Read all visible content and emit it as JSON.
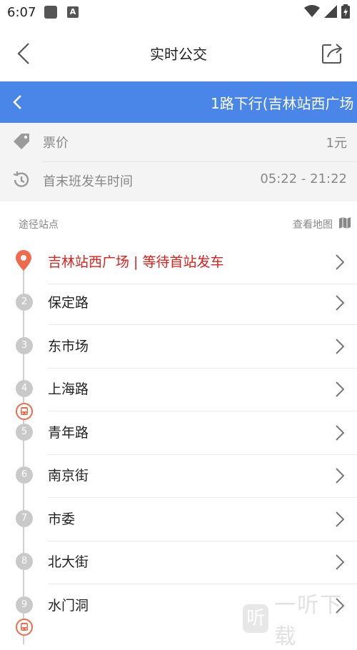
{
  "status_bar": {
    "time": "6:07",
    "notif_icon_letter": "A"
  },
  "app_bar": {
    "title": "实时公交"
  },
  "route_bar": {
    "route_title": "1路下行(吉林站西广场",
    "background": "#4a86e8"
  },
  "info": {
    "fare_label": "票价",
    "fare_value": "1元",
    "time_label": "首末班发车时间",
    "time_value": "05:22 - 21:22"
  },
  "stops_header": {
    "left": "途径站点",
    "right": "查看地图"
  },
  "stops": [
    {
      "index": "1",
      "name": "吉林站西广场 | 等待首站发车",
      "first": true
    },
    {
      "index": "2",
      "name": "保定路"
    },
    {
      "index": "3",
      "name": "东市场"
    },
    {
      "index": "4",
      "name": "上海路"
    },
    {
      "index": "5",
      "name": "青年路"
    },
    {
      "index": "6",
      "name": "南京街"
    },
    {
      "index": "7",
      "name": "市委"
    },
    {
      "index": "8",
      "name": "北大街"
    },
    {
      "index": "9",
      "name": "水门洞"
    }
  ],
  "watermark": {
    "logo_char": "听",
    "text": "一听下载"
  },
  "colors": {
    "accent": "#4a86e8",
    "first_stop": "#e0201a",
    "bus_icon": "#f06a4c"
  }
}
